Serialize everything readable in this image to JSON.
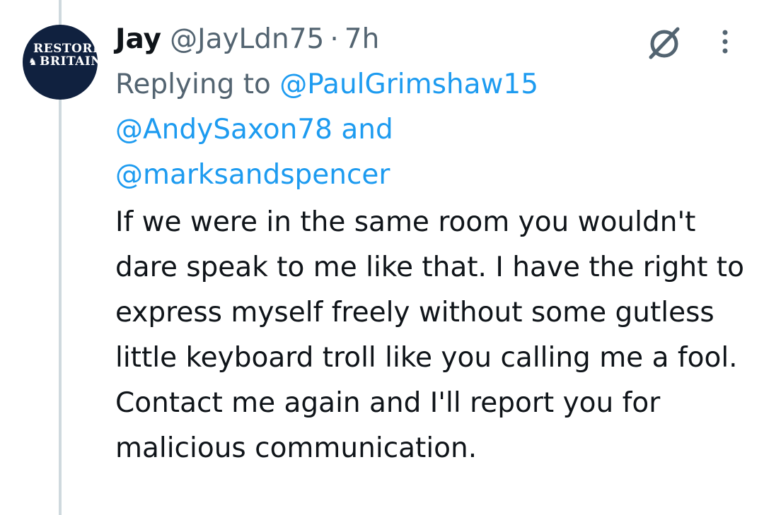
{
  "avatar": {
    "line1": "RESTORE",
    "line2": "BRITAIN",
    "background": "#10213f"
  },
  "author": {
    "name": "Jay",
    "handle": "@JayLdn75",
    "separator": "·",
    "time": "7h"
  },
  "icons": {
    "grok": "grok-icon",
    "more": "more-vertical-icon"
  },
  "reply": {
    "prefix": "Replying to",
    "mention1": "@PaulGrimshaw15",
    "mention2": "@AndySaxon78",
    "conjunction": "and",
    "mention3": "@marksandspencer"
  },
  "tweet": {
    "text": "If we were in the same room you wouldn't dare speak to me like that. I have the right to express myself freely without some gutless little keyboard troll like you calling me a fool. Contact me again and I'll report you for malicious communication."
  },
  "colors": {
    "text": "#0f1419",
    "secondary": "#536471",
    "link": "#1d9bf0",
    "thread_line": "#cfd9de"
  }
}
